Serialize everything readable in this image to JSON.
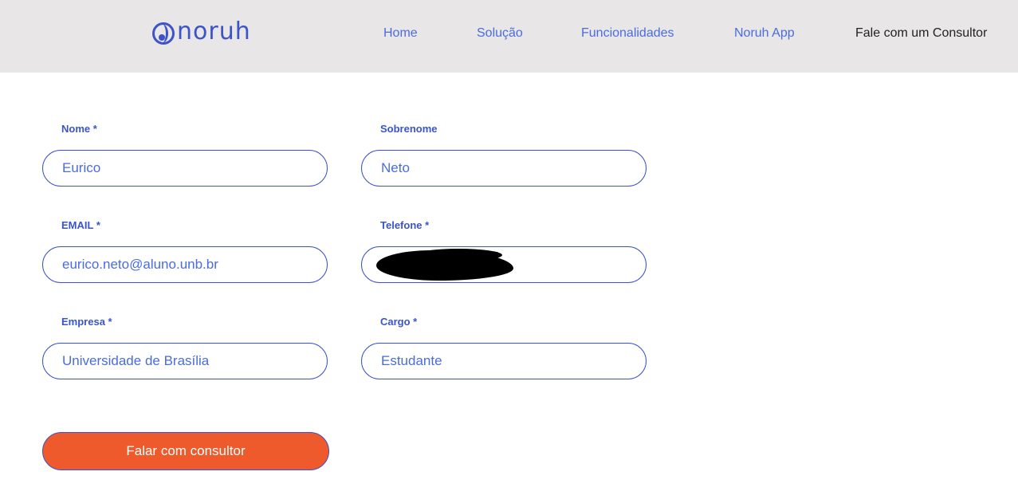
{
  "header": {
    "logo_text": "noruh",
    "brand_color": "#3b54c8",
    "background_color": "#e8e6e7",
    "nav": {
      "home": "Home",
      "solucao": "Solução",
      "funcionalidades": "Funcionalidades",
      "app": "Noruh App",
      "cta": "Fale com um Consultor"
    }
  },
  "form": {
    "nome": {
      "label": "Nome *",
      "value": "Eurico"
    },
    "sobrenome": {
      "label": "Sobrenome",
      "value": "Neto"
    },
    "email": {
      "label": "EMAIL *",
      "value": "eurico.neto@aluno.unb.br"
    },
    "telefone": {
      "label": "Telefone *",
      "value": ""
    },
    "empresa": {
      "label": "Empresa *",
      "value": "Universidade de Brasília"
    },
    "cargo": {
      "label": "Cargo *",
      "value": "Estudante"
    },
    "submit_label": "Falar com consultor",
    "submit_color": "#ee5a2b"
  }
}
